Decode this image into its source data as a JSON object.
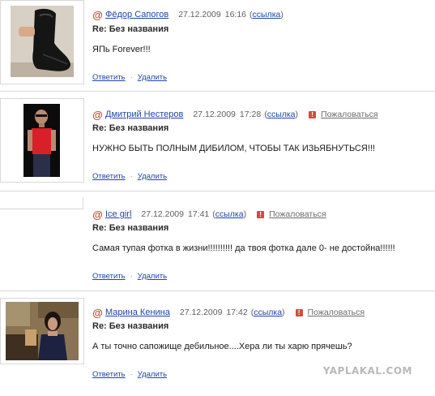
{
  "comments": [
    {
      "username": "Фёдор Сапогов",
      "date": "27.12.2009",
      "time": "16:16",
      "link_label": "ссылка",
      "report_label": "",
      "subject": "Re: Без названия",
      "text": "ЯПь Forever!!!",
      "reply_label": "Ответить",
      "delete_label": "Удалить",
      "avatar": "boot-photo"
    },
    {
      "username": "Дмитрий Нестеров",
      "date": "27.12.2009",
      "time": "17:28",
      "link_label": "ссылка",
      "report_label": "Пожаловаться",
      "subject": "Re: Без названия",
      "text": "НУЖНО БЫТЬ ПОЛНЫМ ДИБИЛОМ, ЧТОБЫ ТАК ИЗЬЯБНУТЬСЯ!!!",
      "reply_label": "Ответить",
      "delete_label": "Удалить",
      "avatar": "man-red-shirt-photo"
    },
    {
      "username": "Ice girl",
      "date": "27.12.2009",
      "time": "17:41",
      "link_label": "ссылка",
      "report_label": "Пожаловаться",
      "subject": "Re: Без названия",
      "text": "Самая тупая фотка в жизни!!!!!!!!!! да твоя фотка дале 0- не достойна!!!!!!",
      "reply_label": "Ответить",
      "delete_label": "Удалить",
      "avatar": ""
    },
    {
      "username": "Марина Кенина",
      "date": "27.12.2009",
      "time": "17:42",
      "link_label": "ссылка",
      "report_label": "Пожаловаться",
      "subject": "Re: Без названия",
      "text": "А ты точно сапожище дебильное....Хера ли ты харю прячешь?",
      "reply_label": "Ответить",
      "delete_label": "Удалить",
      "avatar": "woman-photo"
    }
  ],
  "watermark": "YAPLAKAL.COM",
  "colors": {
    "link": "#1f46a8",
    "at_icon": "#d0452e",
    "report_icon": "#d64b3b",
    "divider": "#d9d9d9"
  },
  "icons": {
    "at": "at-icon",
    "report": "report-icon"
  }
}
